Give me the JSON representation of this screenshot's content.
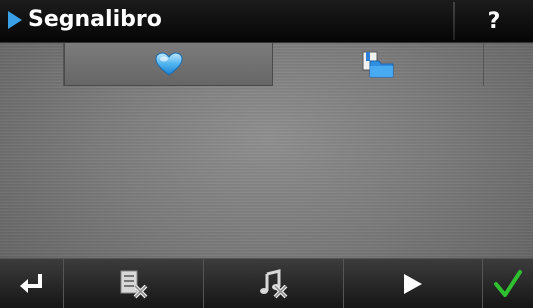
{
  "title": {
    "text": "Segnalibro"
  },
  "help": {
    "label": "?"
  },
  "tabs": [
    {
      "icon": "heart-icon",
      "selected": true
    },
    {
      "icon": "bookmark-folder-icon",
      "selected": false
    }
  ],
  "toolbar": {
    "buttons": [
      {
        "icon": "enter-back-icon"
      },
      {
        "icon": "delete-list-icon"
      },
      {
        "icon": "delete-music-icon"
      },
      {
        "icon": "play-next-icon"
      },
      {
        "icon": "checkmark-icon"
      }
    ]
  },
  "colors": {
    "accent_blue": "#3aa0e8",
    "check_green": "#2fbf2f",
    "titlebar": "#0a0a0a",
    "background": "#7a7a7a"
  }
}
